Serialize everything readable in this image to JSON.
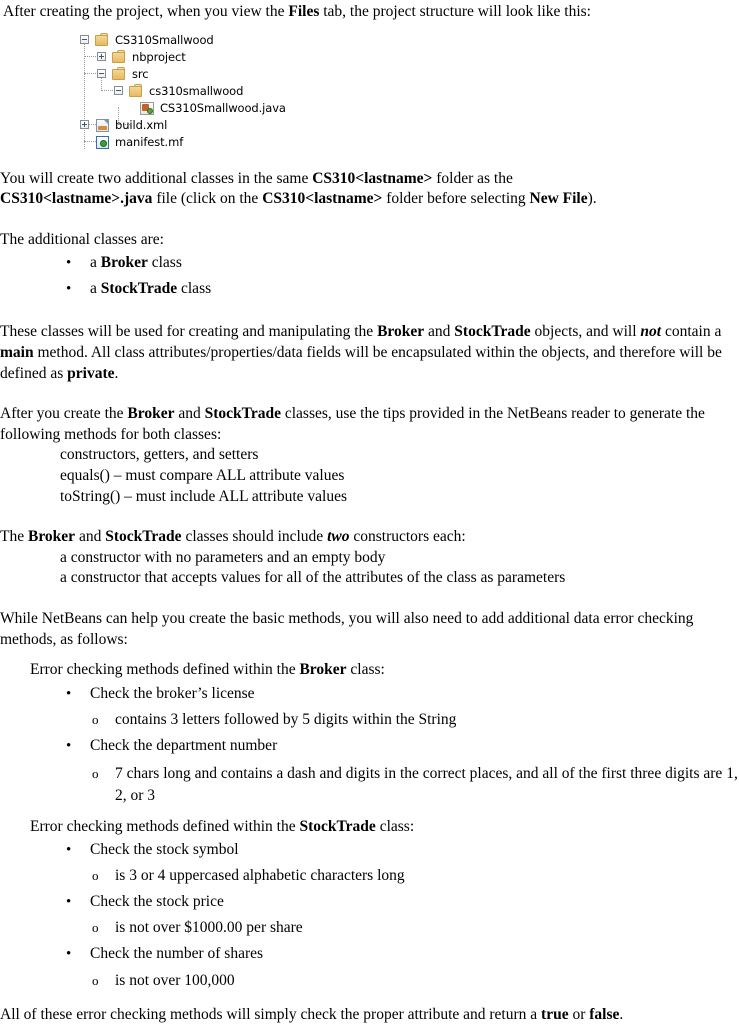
{
  "document": {
    "intro": {
      "before": "After creating the project, when you view the ",
      "bold": "Files",
      "after": " tab, the project structure will look like this:"
    },
    "file_tree": {
      "nodes": [
        {
          "label": "CS310Smallwood",
          "icon": "folder-icon",
          "toggle": "minus",
          "depth": 0
        },
        {
          "label": "nbproject",
          "icon": "folder-icon",
          "toggle": "plus",
          "depth": 1
        },
        {
          "label": "src",
          "icon": "folder-icon",
          "toggle": "minus",
          "depth": 1
        },
        {
          "label": "cs310smallwood",
          "icon": "folder-icon",
          "toggle": "minus",
          "depth": 2
        },
        {
          "label": "CS310Smallwood.java",
          "icon": "java-file-icon",
          "toggle": "none",
          "depth": 3
        },
        {
          "label": "build.xml",
          "icon": "xml-file-icon",
          "toggle": "plus",
          "depth": 1
        },
        {
          "label": "manifest.mf",
          "icon": "manifest-file-icon",
          "toggle": "none",
          "depth": 1
        }
      ]
    },
    "para_create_classes": {
      "line1_a": "You will create two additional classes in the same ",
      "line1_b": "CS310<lastname>",
      "line1_c": " folder as the ",
      "line2_a": "CS310<lastname>.java",
      "line2_b": " file (click on the ",
      "line2_c": "CS310<lastname>",
      "line2_d": " folder before selecting ",
      "line2_e": "New File",
      "line2_f": ")."
    },
    "para_additional": "The additional classes are:",
    "class_list": [
      {
        "prefix": "a ",
        "bold": "Broker",
        "suffix": " class"
      },
      {
        "prefix": "a ",
        "bold": "StockTrade",
        "suffix": " class"
      }
    ],
    "para_usage": {
      "a": "These classes will be used for creating and manipulating the ",
      "b": "Broker",
      "c": " and ",
      "d": "StockTrade",
      "e": " objects, and will ",
      "f": "not",
      "g": " contain a ",
      "h": "main",
      "i": " method.  All class attributes/properties/data fields will be encapsulated within the objects, and therefore will be defined as ",
      "j": "private",
      "k": "."
    },
    "para_generate": {
      "a": "After you create the ",
      "b": "Broker",
      "c": " and ",
      "d": "StockTrade",
      "e": " classes, use the tips provided in the NetBeans reader to generate the following methods for both classes:"
    },
    "methods": [
      "constructors, getters, and setters",
      "equals() – must compare ALL attribute values",
      "toString() – must include ALL attribute values"
    ],
    "para_constructors": {
      "a": "The ",
      "b": "Broker",
      "c": " and ",
      "d": "StockTrade",
      "e": " classes should include ",
      "f": "two",
      "g": " constructors each:"
    },
    "constructors": [
      "a constructor with no parameters and an empty body",
      "a constructor that accepts values for all of the attributes of the class as parameters"
    ],
    "para_error_intro": "While NetBeans can help you create the basic methods, you will also need to add additional data error checking methods, as follows:",
    "broker_section": {
      "heading_a": "Error checking methods defined within the ",
      "heading_b": "Broker",
      "heading_c": " class:",
      "items": [
        {
          "label": "Check the broker’s license",
          "subitems": [
            "contains 3 letters followed by 5 digits within the String"
          ]
        },
        {
          "label": "Check the department number",
          "subitems": [
            "7 chars long and contains a dash and digits in the correct places, and all of the first three digits are 1, 2, or 3"
          ]
        }
      ]
    },
    "stocktrade_section": {
      "heading_a": "Error checking methods defined within the ",
      "heading_b": "StockTrade",
      "heading_c": " class:",
      "items": [
        {
          "label": "Check the stock symbol",
          "subitems": [
            "is 3 or 4 uppercased alphabetic characters long"
          ]
        },
        {
          "label": "Check the stock price",
          "subitems": [
            "is not over $1000.00 per share"
          ]
        },
        {
          "label": "Check the number of shares",
          "subitems": [
            "is not over 100,000"
          ]
        }
      ]
    },
    "para_closing": {
      "a": "All of these error checking methods will simply check the proper attribute and return a ",
      "b": "true",
      "c": " or ",
      "d": "false",
      "e": "."
    },
    "symbols": {
      "bullet": "•",
      "circle": "o"
    }
  }
}
